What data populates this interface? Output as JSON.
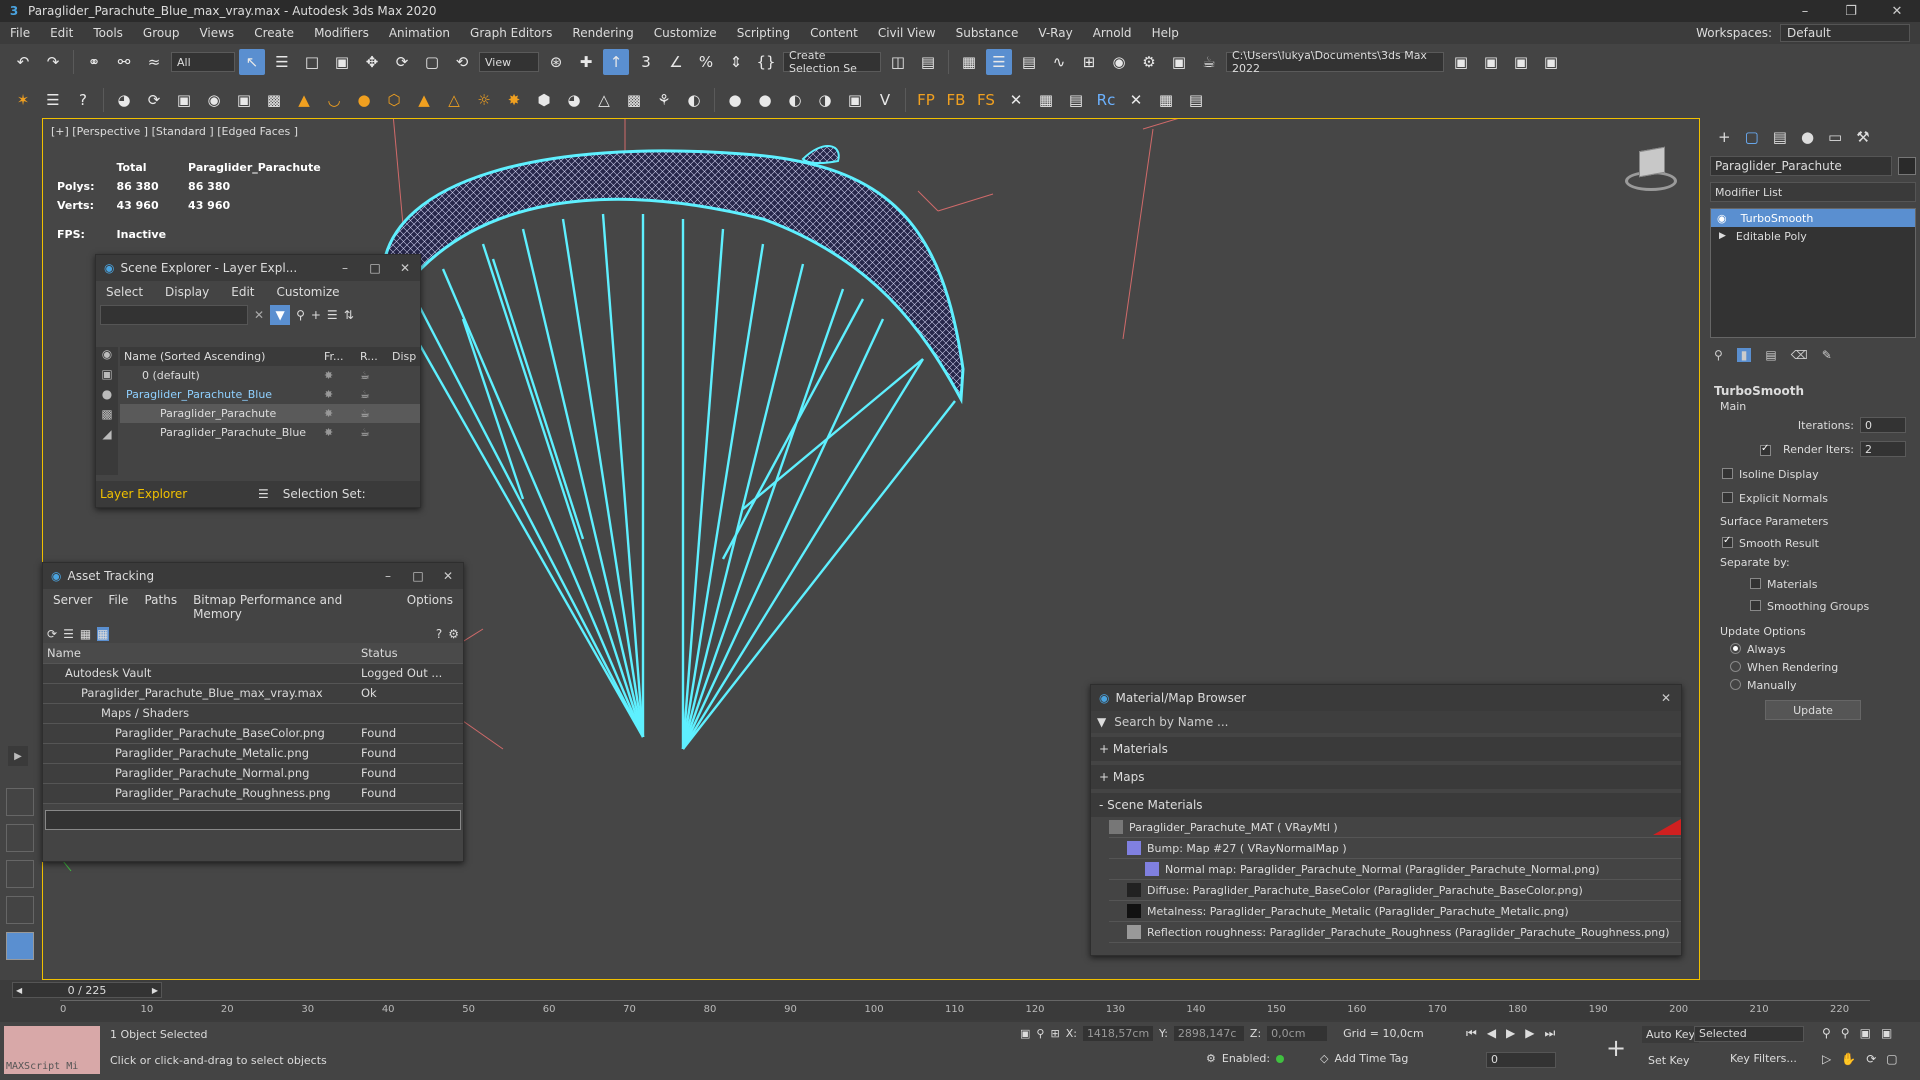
{
  "window": {
    "title": "Paraglider_Parachute_Blue_max_vray.max - Autodesk 3ds Max 2020"
  },
  "menu": [
    "File",
    "Edit",
    "Tools",
    "Group",
    "Views",
    "Create",
    "Modifiers",
    "Animation",
    "Graph Editors",
    "Rendering",
    "Customize",
    "Scripting",
    "Content",
    "Civil View",
    "Substance",
    "V-Ray",
    "Arnold",
    "Help"
  ],
  "workspace": {
    "label": "Workspaces:",
    "value": "Default"
  },
  "toolbar": {
    "filter": "All",
    "ref_coord": "View",
    "selection_set": "Create Selection Se",
    "project_path": "C:\\Users\\lukya\\Documents\\3ds Max 2022"
  },
  "viewport": {
    "label": "[+] [Perspective ] [Standard ] [Edged Faces ]",
    "stats": {
      "col_total": "Total",
      "col_object": "Paraglider_Parachute",
      "polys_label": "Polys:",
      "polys_total": "86 380",
      "polys_obj": "86 380",
      "verts_label": "Verts:",
      "verts_total": "43 960",
      "verts_obj": "43 960",
      "fps_label": "FPS:",
      "fps_value": "Inactive"
    }
  },
  "scene_explorer": {
    "title": "Scene Explorer - Layer Expl...",
    "menu": [
      "Select",
      "Display",
      "Edit",
      "Customize"
    ],
    "columns": {
      "name": "Name (Sorted Ascending)",
      "fr": "Fr...",
      "r": "R...",
      "disp": "Disp"
    },
    "rows": [
      {
        "name": "0 (default)"
      },
      {
        "name": "Paraglider_Parachute_Blue"
      },
      {
        "name": "Paraglider_Parachute"
      },
      {
        "name": "Paraglider_Parachute_Blue"
      }
    ],
    "footer": {
      "mode": "Layer Explorer",
      "selection_set": "Selection Set:"
    }
  },
  "asset_tracking": {
    "title": "Asset Tracking",
    "menu": [
      "Server",
      "File",
      "Paths",
      "Bitmap Performance and Memory",
      "Options"
    ],
    "col_name": "Name",
    "col_status": "Status",
    "rows": [
      {
        "name": "Autodesk Vault",
        "status": "Logged Out ..."
      },
      {
        "name": "Paraglider_Parachute_Blue_max_vray.max",
        "status": "Ok"
      },
      {
        "name": "Maps / Shaders",
        "status": ""
      },
      {
        "name": "Paraglider_Parachute_BaseColor.png",
        "status": "Found"
      },
      {
        "name": "Paraglider_Parachute_Metalic.png",
        "status": "Found"
      },
      {
        "name": "Paraglider_Parachute_Normal.png",
        "status": "Found"
      },
      {
        "name": "Paraglider_Parachute_Roughness.png",
        "status": "Found"
      }
    ]
  },
  "material_browser": {
    "title": "Material/Map Browser",
    "search_placeholder": "Search by Name ...",
    "sections": [
      "+ Materials",
      "+ Maps",
      "- Scene Materials"
    ],
    "items": [
      "Paraglider_Parachute_MAT  ( VRayMtl )",
      "Bump: Map #27  ( VRayNormalMap )",
      "Normal map: Paraglider_Parachute_Normal (Paraglider_Parachute_Normal.png)",
      "Diffuse: Paraglider_Parachute_BaseColor (Paraglider_Parachute_BaseColor.png)",
      "Metalness: Paraglider_Parachute_Metalic (Paraglider_Parachute_Metalic.png)",
      "Reflection roughness: Paraglider_Parachute_Roughness (Paraglider_Parachute_Roughness.png)"
    ]
  },
  "command_panel": {
    "object_name": "Paraglider_Parachute",
    "modifier_list": "Modifier List",
    "stack": [
      "TurboSmooth",
      "Editable Poly"
    ],
    "rollout_title": "TurboSmooth",
    "main_label": "Main",
    "iterations_label": "Iterations:",
    "iterations_value": "0",
    "render_iters_label": "Render Iters:",
    "render_iters_value": "2",
    "isoline": "Isoline Display",
    "explicit": "Explicit Normals",
    "surface_params": "Surface Parameters",
    "smooth_result": "Smooth Result",
    "separate_by": "Separate by:",
    "materials": "Materials",
    "smoothing_groups": "Smoothing Groups",
    "update_options": "Update Options",
    "always": "Always",
    "when_rendering": "When Rendering",
    "manually": "Manually",
    "update_btn": "Update"
  },
  "timeline": {
    "frame_counter": "0 / 225",
    "ticks": [
      "0",
      "10",
      "20",
      "30",
      "40",
      "50",
      "60",
      "70",
      "80",
      "90",
      "100",
      "110",
      "120",
      "130",
      "140",
      "150",
      "160",
      "170",
      "180",
      "190",
      "200",
      "210",
      "220"
    ]
  },
  "status": {
    "maxscript": "MAXScript Mi",
    "selected": "1 Object Selected",
    "hint": "Click or click-and-drag to select objects",
    "x_label": "X:",
    "x_value": "1418,57cm",
    "y_label": "Y:",
    "y_value": "2898,147c",
    "z_label": "Z:",
    "z_value": "0,0cm",
    "grid": "Grid = 10,0cm",
    "enabled": "Enabled:",
    "add_time_tag": "Add Time Tag",
    "auto_key": "Auto Key",
    "set_key": "Set Key",
    "selected_dd": "Selected",
    "key_filters": "Key Filters...",
    "frame": "0"
  }
}
